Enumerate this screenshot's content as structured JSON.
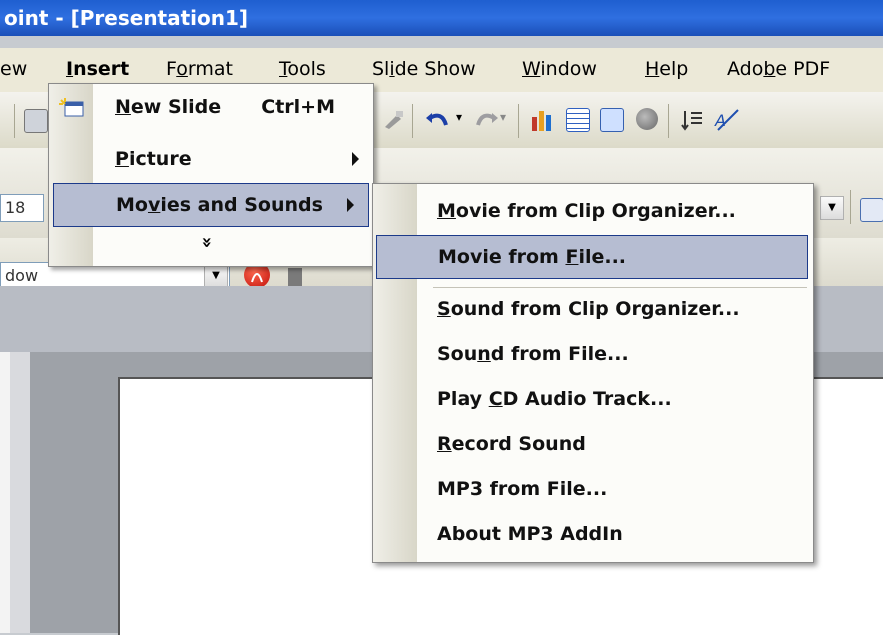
{
  "window": {
    "title": "oint - [Presentation1]"
  },
  "menubar": {
    "items": [
      {
        "pre": "",
        "u": "",
        "post": "ew"
      },
      {
        "pre": "",
        "u": "I",
        "post": "nsert"
      },
      {
        "pre": "F",
        "u": "o",
        "post": "rmat"
      },
      {
        "pre": "",
        "u": "T",
        "post": "ools"
      },
      {
        "pre": "Sl",
        "u": "i",
        "post": "de Show"
      },
      {
        "pre": "",
        "u": "W",
        "post": "indow"
      },
      {
        "pre": "",
        "u": "H",
        "post": "elp"
      },
      {
        "pre": "Ado",
        "u": "b",
        "post": "e PDF"
      }
    ]
  },
  "toolbar": {
    "font_size_value": "18",
    "style_combo_value": "dow"
  },
  "insert_menu": {
    "items": [
      {
        "pre": "",
        "u": "N",
        "post": "ew Slide",
        "shortcut": "Ctrl+M"
      },
      {
        "pre": "",
        "u": "P",
        "post": "icture",
        "has_submenu": true
      },
      {
        "pre": "Mo",
        "u": "v",
        "post": "ies and Sounds",
        "has_submenu": true,
        "highlighted": true
      }
    ],
    "expand_glyph": "»"
  },
  "movies_sounds_menu": {
    "items": [
      {
        "pre": "",
        "u": "M",
        "post": "ovie from Clip Organizer..."
      },
      {
        "pre": "Movie from ",
        "u": "F",
        "post": "ile...",
        "highlighted": true
      },
      {
        "pre": "",
        "u": "S",
        "post": "ound from Clip Organizer..."
      },
      {
        "pre": "Sou",
        "u": "n",
        "post": "d from File..."
      },
      {
        "pre": "Play ",
        "u": "C",
        "post": "D Audio Track..."
      },
      {
        "pre": "",
        "u": "R",
        "post": "ecord Sound"
      },
      {
        "pre": "MP3 from File...",
        "u": "",
        "post": ""
      },
      {
        "pre": "About MP3 AddIn",
        "u": "",
        "post": ""
      }
    ]
  }
}
